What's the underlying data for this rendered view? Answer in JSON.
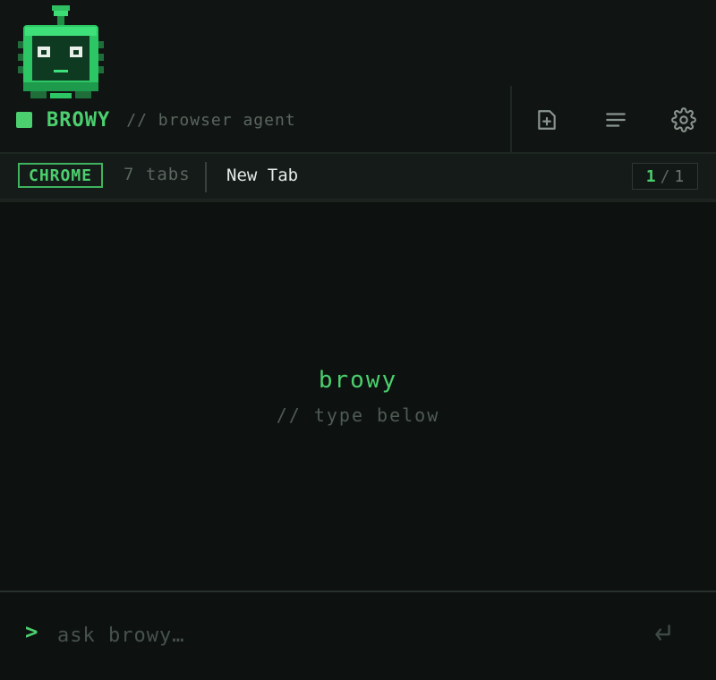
{
  "colors": {
    "accent": "#4ccf6f",
    "background": "#0d1210",
    "muted": "#5b665f",
    "icon": "#8a948e"
  },
  "header": {
    "logo_icon": "robot-mascot-icon",
    "status": "online",
    "brand_name": "BROWY",
    "brand_subtitle": "// browser agent",
    "actions": [
      {
        "name": "new-chat",
        "icon": "file-plus-icon"
      },
      {
        "name": "history",
        "icon": "menu-lines-icon"
      },
      {
        "name": "settings",
        "icon": "gear-icon"
      }
    ]
  },
  "tabbar": {
    "browser": "CHROME",
    "tab_count": "7 tabs",
    "active_tab_title": "New Tab",
    "pager": {
      "current": "1",
      "separator": "/",
      "total": "1"
    }
  },
  "main": {
    "empty_title": "browy",
    "empty_subtitle": "// type below"
  },
  "composer": {
    "prompt_symbol": ">",
    "placeholder": "ask browy…",
    "value": "",
    "send_icon": "enter-return-icon"
  }
}
